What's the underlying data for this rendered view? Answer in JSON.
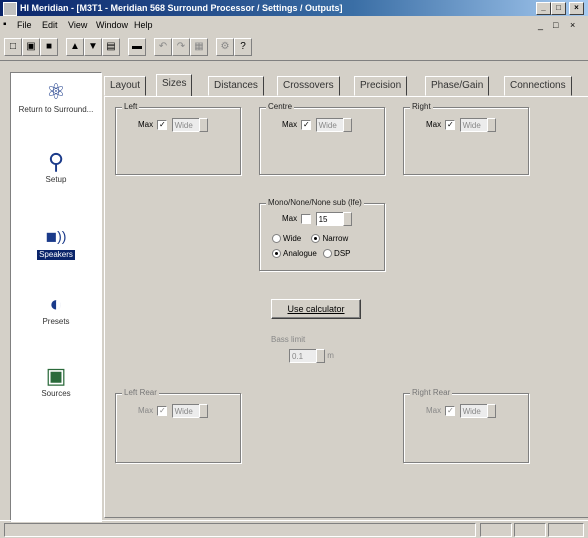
{
  "window": {
    "title": "HI Meridian - [M3T1 - Meridian 568 Surround Processor / Settings / Outputs]",
    "controls": [
      "_",
      "□",
      "×"
    ],
    "mdi_controls": [
      "_",
      "□",
      "×"
    ]
  },
  "menu": [
    "File",
    "Edit",
    "View",
    "Window",
    "Help"
  ],
  "toolbar": {
    "icons": [
      "new-icon",
      "open-icon",
      "save-icon",
      "upload-icon",
      "download-icon",
      "print-icon",
      "device-icon",
      "undo-icon",
      "redo-icon",
      "copy-icon",
      "settings-icon",
      "help-icon"
    ],
    "glyphs": [
      "□",
      "▣",
      "■",
      "▲",
      "▼",
      "▤",
      "▬",
      "↶",
      "↷",
      "▦",
      "⚙",
      "?"
    ]
  },
  "sidebar": {
    "items": [
      {
        "label": "Return to Surround...",
        "icon": "speaker-return-icon",
        "glyph": "⚛"
      },
      {
        "label": "Setup",
        "icon": "magnifier-icon",
        "glyph": "⚲"
      },
      {
        "label": "Speakers",
        "icon": "speaker-waves-icon",
        "glyph": "◼))",
        "selected": true
      },
      {
        "label": "Presets",
        "icon": "ear-icon",
        "glyph": "◐"
      },
      {
        "label": "Sources",
        "icon": "monitor-icon",
        "glyph": "▣"
      }
    ]
  },
  "tabs": [
    "Layout",
    "Sizes",
    "Distances",
    "Crossovers",
    "Precision",
    "Phase/Gain",
    "Connections"
  ],
  "active_tab": "Sizes",
  "groups": {
    "left": {
      "label": "Left",
      "max_label": "Max",
      "checked": true,
      "value": "Wide"
    },
    "centre": {
      "label": "Centre",
      "max_label": "Max",
      "checked": true,
      "value": "Wide"
    },
    "right": {
      "label": "Right",
      "max_label": "Max",
      "checked": true,
      "value": "Wide"
    },
    "mono": {
      "label": "Mono/None/None sub (lfe)",
      "max_label": "Max",
      "checked": false,
      "value": "15",
      "radio1": [
        "Wide",
        "Narrow"
      ],
      "radio1_selected": "Narrow",
      "radio2": [
        "Analogue",
        "DSP"
      ],
      "radio2_selected": "Analogue"
    },
    "left_rear": {
      "label": "Left Rear",
      "max_label": "Max",
      "checked": true,
      "value": "Wide"
    },
    "right_rear": {
      "label": "Right Rear",
      "max_label": "Max",
      "checked": true,
      "value": "Wide"
    }
  },
  "calc_button": "Use calculator",
  "extra": {
    "label": "Bass limit",
    "value": "0.1",
    "unit": "m"
  }
}
